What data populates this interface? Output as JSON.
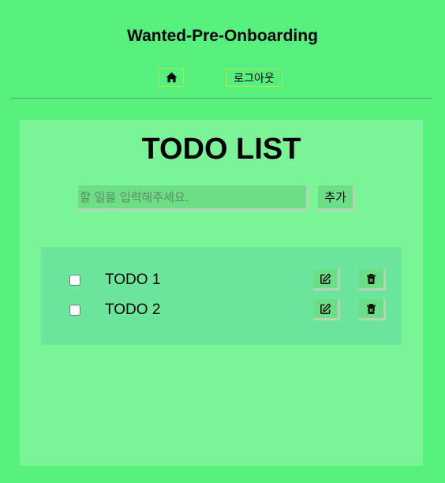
{
  "app": {
    "title": "Wanted-Pre-Onboarding"
  },
  "nav": {
    "home_icon": "home-icon",
    "logout_label": "로그아웃"
  },
  "todo": {
    "heading": "TODO LIST",
    "input": {
      "value": "",
      "placeholder": "할 일을 입력해주세요."
    },
    "add_label": "추가",
    "items": [
      {
        "label": "TODO 1",
        "checked": false,
        "edit_icon": "edit-icon",
        "delete_icon": "trash-icon"
      },
      {
        "label": "TODO 2",
        "checked": false,
        "edit_icon": "edit-icon",
        "delete_icon": "trash-icon"
      }
    ]
  },
  "colors": {
    "background": "#56f07f",
    "panel": "#7bf497",
    "list": "#6ce59d",
    "button": "#6cdf86"
  }
}
